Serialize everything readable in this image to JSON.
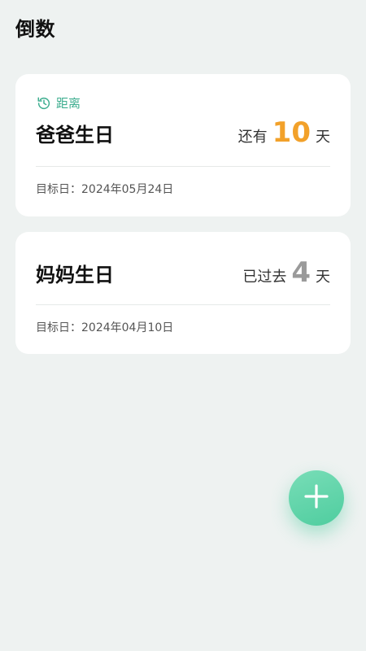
{
  "header": {
    "title": "倒数"
  },
  "countdowns": [
    {
      "tag": "距离",
      "name": "爸爸生日",
      "prefix": "还有",
      "number": "10",
      "unit": "天",
      "target_label": "目标日：",
      "target_date": "2024年05月24日"
    },
    {
      "name": "妈妈生日",
      "prefix": "已过去",
      "number": "4",
      "unit": "天",
      "target_label": "目标日：",
      "target_date": "2024年04月10日"
    }
  ],
  "colors": {
    "background": "#eef2f1",
    "accent_green": "#3fae90",
    "future_number": "#f2a12a",
    "past_number": "#9a9a9a",
    "fab": "#5ed1a6"
  },
  "icons": {
    "distance_tag": "history-icon",
    "fab": "plus-icon"
  }
}
